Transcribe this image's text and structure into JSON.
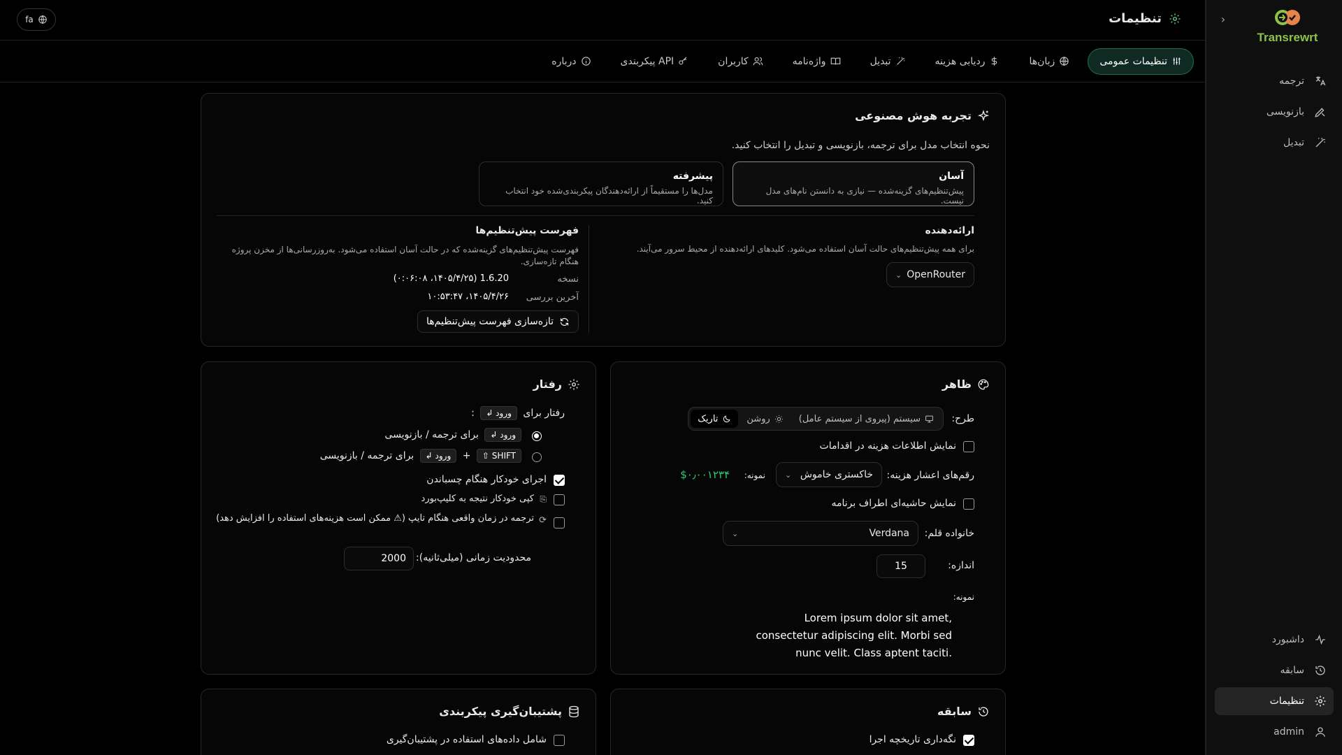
{
  "app": {
    "name": "Transrewrt",
    "language": "fa"
  },
  "sidebar": {
    "items_top": [
      {
        "label": "ترجمه",
        "icon": "translate-icon"
      },
      {
        "label": "بازنویسی",
        "icon": "pen-icon"
      },
      {
        "label": "تبدیل",
        "icon": "wand-icon"
      }
    ],
    "items_bottom": [
      {
        "label": "داشبورد",
        "icon": "activity-icon"
      },
      {
        "label": "سابقه",
        "icon": "history-icon"
      },
      {
        "label": "تنظیمات",
        "icon": "gear-icon"
      },
      {
        "label": "admin",
        "icon": "user-icon"
      }
    ]
  },
  "header": {
    "title": "تنظیمات"
  },
  "tabs": [
    {
      "label": "تنظیمات عمومی",
      "icon": "sliders-icon"
    },
    {
      "label": "زبان‌ها",
      "icon": "globe-icon"
    },
    {
      "label": "ردیابی هزینه",
      "icon": "dollar-icon"
    },
    {
      "label": "تبدیل",
      "icon": "wand-icon"
    },
    {
      "label": "واژه‌نامه",
      "icon": "book-icon"
    },
    {
      "label": "کاربران",
      "icon": "users-icon"
    },
    {
      "label": "پیکربندی API",
      "icon": "key-icon"
    },
    {
      "label": "درباره",
      "icon": "info-icon"
    }
  ],
  "ai": {
    "title": "تجربه هوش مصنوعی",
    "description": "نحوه انتخاب مدل برای ترجمه، بازنویسی و تبدیل را انتخاب کنید.",
    "modes": [
      {
        "title": "آسان",
        "desc": "پیش‌تنظیم‌های گزینه‌شده — نیازی به دانستن نام‌های مدل نیست."
      },
      {
        "title": "پیشرفته",
        "desc": "مدل‌ها را مستقیماً از ارائه‌دهندگان پیکربندی‌شده خود انتخاب کنید."
      }
    ],
    "provider": {
      "label": "ارائه‌دهنده",
      "desc": "برای همه پیش‌تنظیم‌های حالت آسان استفاده می‌شود. کلیدهای ارائه‌دهنده از محیط سرور می‌آیند.",
      "value": "OpenRouter"
    },
    "catalog": {
      "label": "فهرست پیش‌تنظیم‌ها",
      "desc": "فهرست پیش‌تنظیم‌های گزینه‌شده که در حالت آسان استفاده می‌شود. به‌روزرسانی‌ها از مخزن پروژه هنگام تازه‌سازی.",
      "version_label": "نسخه",
      "version_value": "1.6.20 (۱۴۰۵/۴/۲۵، ۰:۰۶:۰۸)",
      "checked_label": "آخرین بررسی",
      "checked_value": "۱۴۰۵/۴/۲۶، ۱۰:۵۳:۴۷",
      "refresh_label": "تازه‌سازی فهرست پیش‌تنظیم‌ها"
    }
  },
  "appearance": {
    "title": "ظاهر",
    "theme_label": "طرح:",
    "theme_options": [
      "سیستم (پیروی از سیستم عامل)",
      "روشن",
      "تاریک"
    ],
    "show_cost_label": "نمایش اطلاعات هزینه در اقدامات",
    "cost_decimals_label": "رقم‌های اعشار هزینه:",
    "cost_decimals_value": "خاکستری خاموش",
    "sample_label": "نمونه:",
    "sample_value": "$۰٫۰۰۱۲۳۴",
    "border_label": "نمایش حاشیه‌ای اطراف برنامه",
    "font_family_label": "خانواده قلم:",
    "font_family_value": "Verdana",
    "size_label": "اندازه:",
    "size_value": "15",
    "preview_label": "نمونه:",
    "preview_text": "Lorem ipsum dolor sit amet, consectetur adipiscing elit. Morbi sed nunc velit. Class aptent taciti."
  },
  "behavior": {
    "title": "رفتار",
    "behavior_for": "رفتار برای",
    "enter_key": "ورود ↲",
    "shift_key": "SHIFT ⇧",
    "colon": ":",
    "option1": "برای ترجمه / بازنویسی",
    "option2": "برای ترجمه / بازنویسی",
    "plus": "+",
    "autorun_label": "اجرای خودکار هنگام چسباندن",
    "autocopy_label": "کپی خودکار نتیجه به کلیپ‌بورد",
    "realtime_label": "ترجمه در زمان واقعی هنگام تایپ (⚠ ممکن است هزینه‌های استفاده را افزایش دهد)",
    "timeout_label": "محدودیت زمانی (میلی‌ثانیه):",
    "timeout_value": "2000"
  },
  "history": {
    "title": "سابقه",
    "keep_label": "نگه‌داری تاریخچه اجرا"
  },
  "backup": {
    "title": "پشتیبان‌گیری پیکربندی",
    "include_label": "شامل داده‌های استفاده در پشتیبان‌گیری"
  },
  "colors": {
    "accent": "#1f6f52",
    "brand": "#8bc34a",
    "success": "#2ecc71"
  }
}
